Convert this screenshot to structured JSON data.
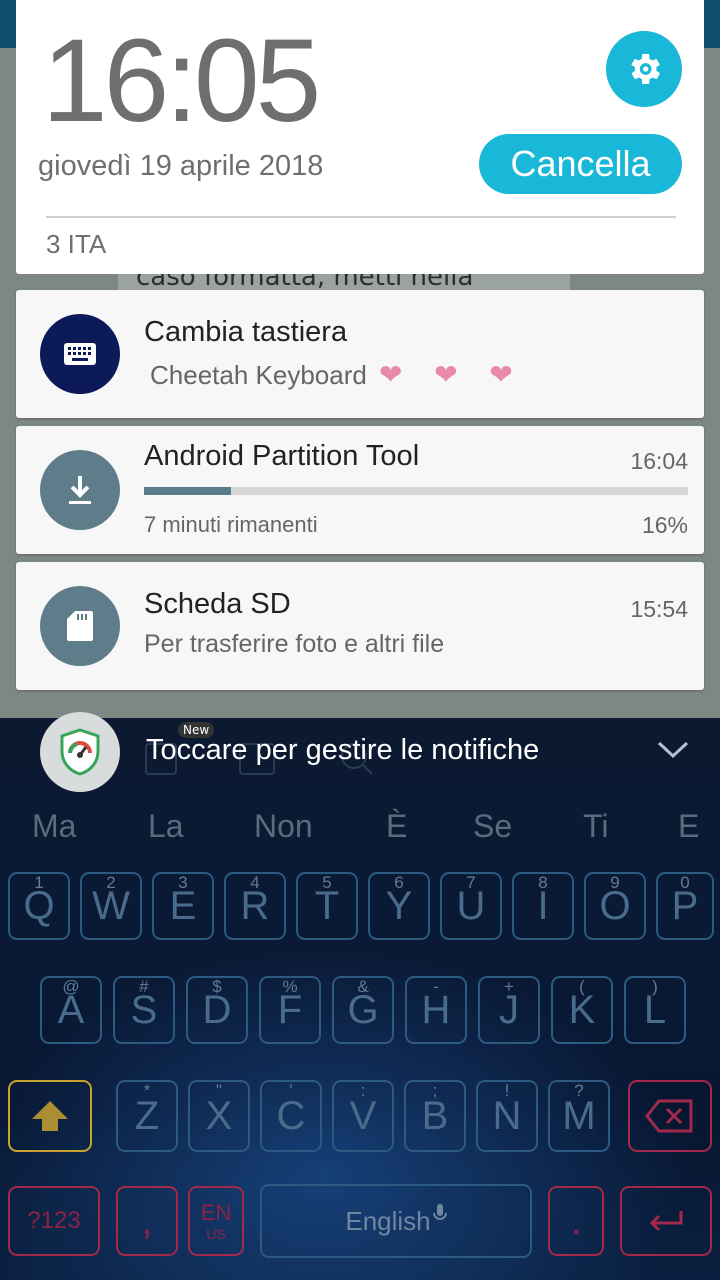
{
  "background": {
    "partial_text": "caso formatta, metti nella"
  },
  "header": {
    "time": "16:05",
    "date": "giovedì 19 aprile 2018",
    "cancel_label": "Cancella",
    "carrier": "3 ITA",
    "accent_color": "#19b8d8"
  },
  "notifications": [
    {
      "title": "Cambia tastiera",
      "subtitle": "Cheetah Keyboard",
      "decoration": "❤ ❤ ❤",
      "icon": "keyboard-icon",
      "icon_color": "#0d1a5a"
    },
    {
      "title": "Android Partition Tool",
      "time": "16:04",
      "progress_text": "7 minuti rimanenti",
      "progress_percent_label": "16%",
      "progress": 0.16,
      "icon": "download-icon",
      "icon_color": "#5e7c8a"
    },
    {
      "title": "Scheda SD",
      "time": "15:54",
      "subtitle": "Per trasferire foto e altri file",
      "icon": "sd-card-icon",
      "icon_color": "#5e7c8a"
    }
  ],
  "manage": {
    "text": "Toccare per gestire le notifiche",
    "badge": "New"
  },
  "keyboard": {
    "suggestions": [
      "Ma",
      "La",
      "Non",
      "È",
      "Se",
      "Ti",
      "E"
    ],
    "row1": [
      {
        "k": "Q",
        "h": "1"
      },
      {
        "k": "W",
        "h": "2"
      },
      {
        "k": "E",
        "h": "3"
      },
      {
        "k": "R",
        "h": "4"
      },
      {
        "k": "T",
        "h": "5"
      },
      {
        "k": "Y",
        "h": "6"
      },
      {
        "k": "U",
        "h": "7"
      },
      {
        "k": "I",
        "h": "8"
      },
      {
        "k": "O",
        "h": "9"
      },
      {
        "k": "P",
        "h": "0"
      }
    ],
    "row2": [
      {
        "k": "A",
        "h": "@"
      },
      {
        "k": "S",
        "h": "#"
      },
      {
        "k": "D",
        "h": "$"
      },
      {
        "k": "F",
        "h": "%"
      },
      {
        "k": "G",
        "h": "&"
      },
      {
        "k": "H",
        "h": "-"
      },
      {
        "k": "J",
        "h": "+"
      },
      {
        "k": "K",
        "h": "("
      },
      {
        "k": "L",
        "h": ")"
      }
    ],
    "row3": [
      {
        "k": "Z",
        "h": "*"
      },
      {
        "k": "X",
        "h": "\""
      },
      {
        "k": "C",
        "h": "'"
      },
      {
        "k": "V",
        "h": ":"
      },
      {
        "k": "B",
        "h": ";"
      },
      {
        "k": "N",
        "h": "!"
      },
      {
        "k": "M",
        "h": "?"
      }
    ],
    "symbols_label": "?123",
    "comma_label": ",",
    "lang_label": "EN",
    "lang_sub": "US",
    "space_label": "English",
    "period_label": "."
  }
}
